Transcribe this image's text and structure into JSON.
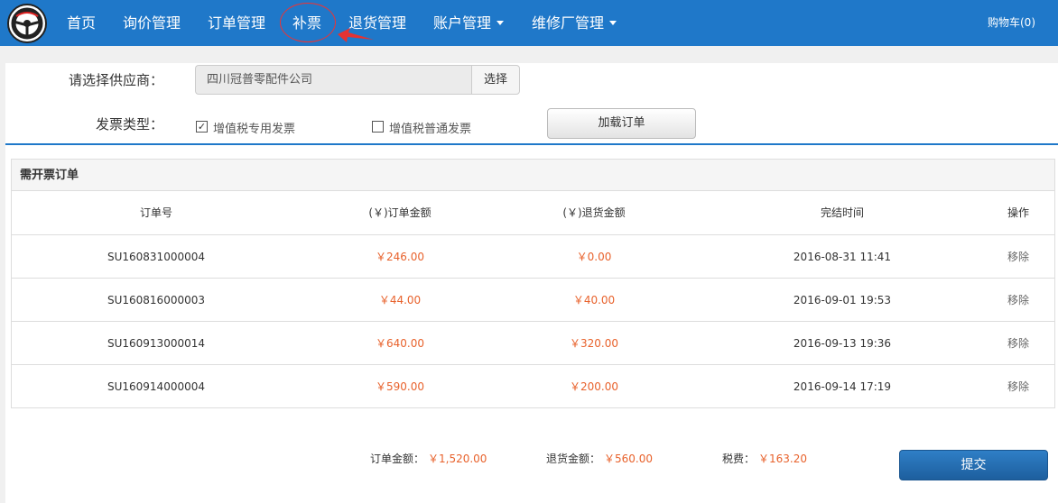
{
  "nav": {
    "items": [
      {
        "label": "首页"
      },
      {
        "label": "询价管理"
      },
      {
        "label": "订单管理"
      },
      {
        "label": "补票"
      },
      {
        "label": "退货管理"
      },
      {
        "label": "账户管理"
      },
      {
        "label": "维修厂管理"
      }
    ],
    "cart": "购物车(0)"
  },
  "form": {
    "supplier_label": "请选择供应商：",
    "supplier_value": "四川冠普零配件公司",
    "select_button": "选择",
    "invoice_type_label": "发票类型：",
    "invoice_options": [
      {
        "label": "增值税专用发票",
        "checked": true
      },
      {
        "label": "增值税普通发票",
        "checked": false
      }
    ],
    "load_button": "加载订单"
  },
  "table": {
    "title": "需开票订单",
    "columns": [
      "订单号",
      "(￥)订单金额",
      "(￥)退货金额",
      "完结时间",
      "操作"
    ],
    "rows": [
      {
        "order_no": "SU160831000004",
        "amount": "￥246.00",
        "refund": "￥0.00",
        "time": "2016-08-31 11:41",
        "action": "移除"
      },
      {
        "order_no": "SU160816000003",
        "amount": "￥44.00",
        "refund": "￥40.00",
        "time": "2016-09-01 19:53",
        "action": "移除"
      },
      {
        "order_no": "SU160913000014",
        "amount": "￥640.00",
        "refund": "￥320.00",
        "time": "2016-09-13 19:36",
        "action": "移除"
      },
      {
        "order_no": "SU160914000004",
        "amount": "￥590.00",
        "refund": "￥200.00",
        "time": "2016-09-14 17:19",
        "action": "移除"
      }
    ]
  },
  "summary": {
    "order_total_label": "订单金额：",
    "order_total": "￥1,520.00",
    "refund_total_label": "退货金额：",
    "refund_total": "￥560.00",
    "tax_label": "税费：",
    "tax": "￥163.20",
    "submit_button": "提交"
  },
  "colors": {
    "navbar": "#1f78c9",
    "money": "#e8622c",
    "annotation": "#e33333"
  }
}
